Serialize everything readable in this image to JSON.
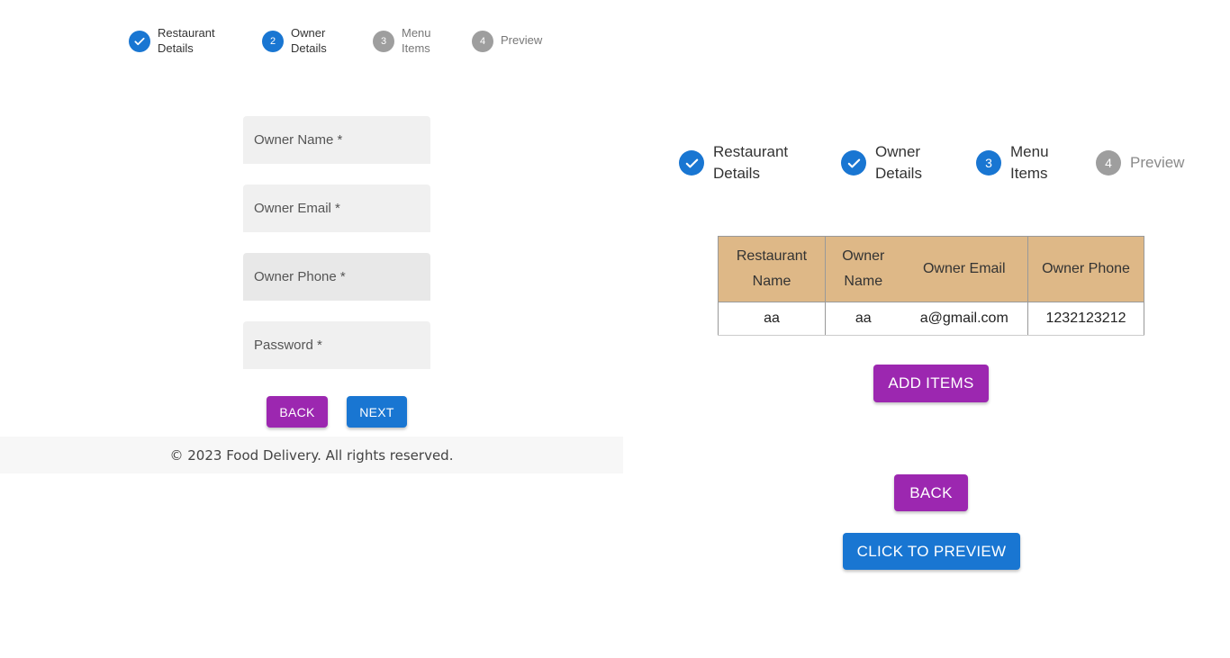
{
  "left": {
    "stepper": [
      {
        "num": "",
        "label": "Restaurant Details",
        "state": "done"
      },
      {
        "num": "2",
        "label": "Owner Details",
        "state": "active"
      },
      {
        "num": "3",
        "label": "Menu Items",
        "state": "inactive"
      },
      {
        "num": "4",
        "label": "Preview",
        "state": "inactive"
      }
    ],
    "form": {
      "owner_name": "Owner Name *",
      "owner_email": "Owner Email *",
      "owner_phone": "Owner Phone *",
      "password": "Password *"
    },
    "back_label": "BACK",
    "next_label": "NEXT",
    "footer": "© 2023 Food Delivery. All rights reserved."
  },
  "right": {
    "stepper": [
      {
        "num": "",
        "label": "Restaurant Details",
        "state": "done"
      },
      {
        "num": "",
        "label": "Owner Details",
        "state": "done"
      },
      {
        "num": "3",
        "label": "Menu Items",
        "state": "active"
      },
      {
        "num": "4",
        "label": "Preview",
        "state": "inactive"
      }
    ],
    "table": {
      "headers": [
        "Restaurant Name",
        "Owner Name",
        "Owner Email",
        "Owner Phone"
      ],
      "rows": [
        [
          "aa",
          "aa",
          "a@gmail.com",
          "1232123212"
        ]
      ]
    },
    "add_items_label": "ADD ITEMS",
    "back_label": "BACK",
    "preview_label": "CLICK TO PREVIEW"
  },
  "colors": {
    "primary": "#1976d2",
    "secondary": "#9c27b0",
    "inactive": "#9e9e9e",
    "table_header": "#deb887"
  },
  "icons": {
    "done": "check-icon"
  }
}
